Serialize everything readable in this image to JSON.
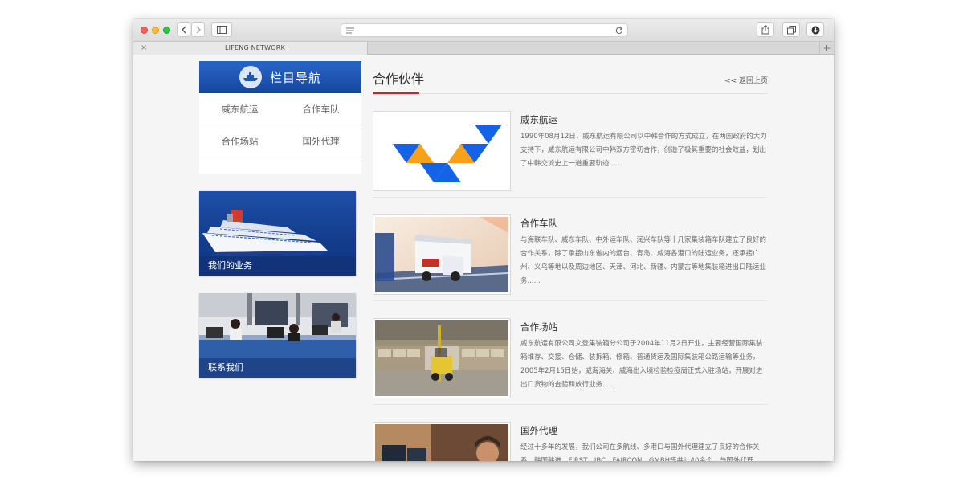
{
  "browser": {
    "tab_title": "LIFENG NETWORK",
    "tab_close": "×",
    "new_tab": "+"
  },
  "sidebar": {
    "title": "栏目导航",
    "nav_items": [
      "威东航运",
      "合作车队",
      "合作场站",
      "国外代理"
    ],
    "promos": [
      {
        "label": "我们的业务"
      },
      {
        "label": "联系我们"
      }
    ]
  },
  "main": {
    "title": "合作伙伴",
    "back_link": "<< 返回上页",
    "entries": [
      {
        "title": "威东航运",
        "desc": "1990年08月12日，威东航运有限公司以中韩合作的方式成立，在两国政府的大力支持下，威东航运有限公司中韩双方密切合作，创造了极其重要的社会效益，划出了中韩交流史上一道重要轨迹......"
      },
      {
        "title": "合作车队",
        "desc": "与海联车队、威东车队、中外运车队、润兴车队等十几家集装箱车队建立了良好的合作关系，除了承接山东省内的烟台、青岛、威海各港口的陆运业务，还承接广州、义乌等地以及周边地区、天津、河北、新疆、内蒙古等地集装箱进出口陆运业务......"
      },
      {
        "title": "合作场站",
        "desc": "威东航运有限公司文登集装箱分公司于2004年11月2日开业，主要经营国际集装箱堆存、交接、仓储、装拆箱、修箱、普通货运及国际集装箱公路运输等业务。2005年2月15日始，威海海关、威海出入境检验检疫局正式入驻场站，开展对进出口货物的查验和放行业务......"
      },
      {
        "title": "国外代理",
        "desc": "经过十多年的发展，我们公司在多航线、多港口与国外代理建立了良好的合作关系，韩国韩进、FIRST、IBC、FAIRCON、GMBH等共计40余个，与国外代理"
      }
    ]
  },
  "colors": {
    "nav_blue": "#1f56b4",
    "accent_red": "#d7192e",
    "logo_blue": "#1463e6",
    "logo_orange": "#f5a11a"
  }
}
